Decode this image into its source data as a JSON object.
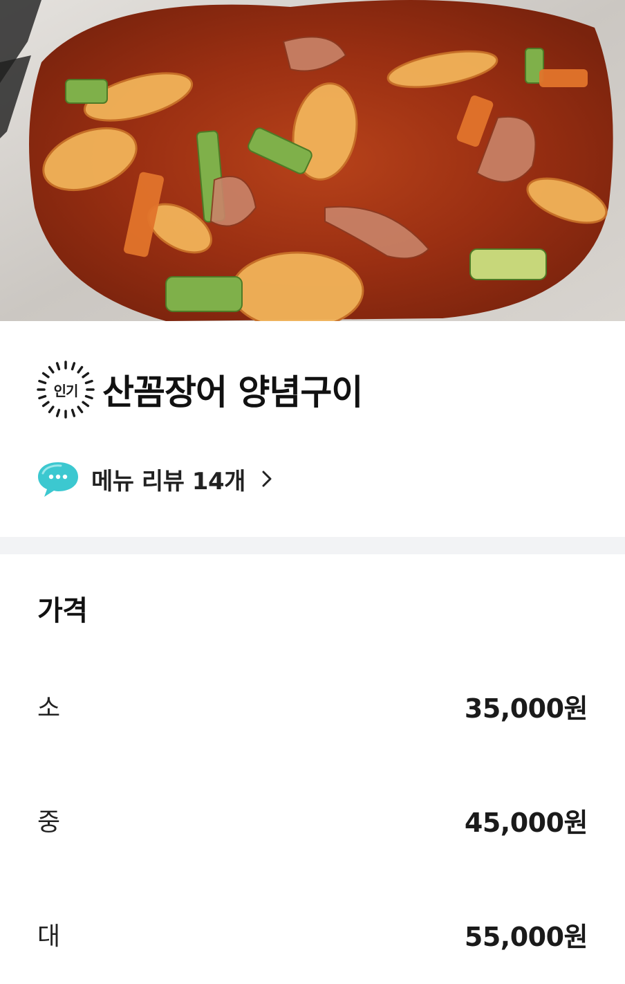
{
  "hero": {
    "image_subject": "food-photo-spicy-grilled-eel"
  },
  "menu": {
    "badge_label": "인기",
    "title": "산꼼장어 양념구이"
  },
  "reviews": {
    "label": "메뉴 리뷰 14개"
  },
  "price_section": {
    "heading": "가격",
    "options": [
      {
        "size": "소",
        "price": "35,000원"
      },
      {
        "size": "중",
        "price": "45,000원"
      },
      {
        "size": "대",
        "price": "55,000원"
      }
    ]
  },
  "colors": {
    "chat_icon": "#3cc8d0",
    "divider": "#f2f3f5",
    "text": "#111111"
  }
}
